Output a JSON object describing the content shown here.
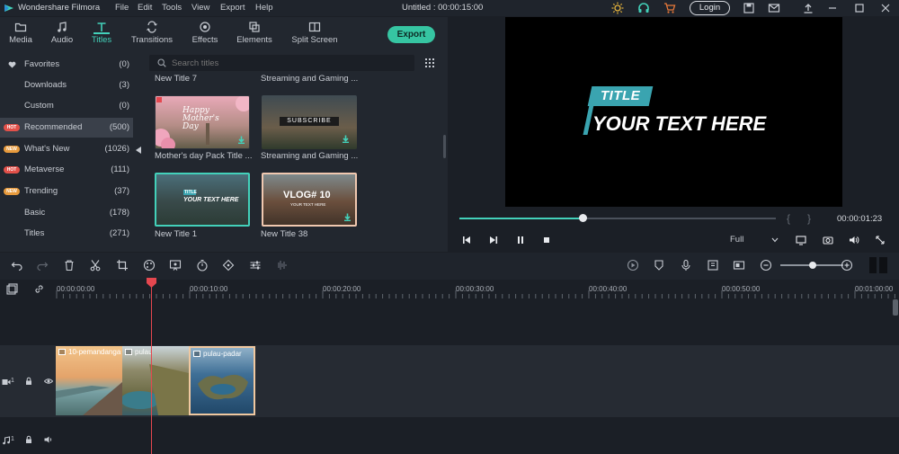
{
  "titlebar": {
    "app_name": "Wondershare Filmora",
    "menus": [
      "File",
      "Edit",
      "Tools",
      "View",
      "Export",
      "Help"
    ],
    "doc_title": "Untitled : 00:00:15:00",
    "login": "Login"
  },
  "tabs": [
    {
      "label": "Media",
      "icon": "folder-icon"
    },
    {
      "label": "Audio",
      "icon": "music-note-icon"
    },
    {
      "label": "Titles",
      "icon": "text-t-icon"
    },
    {
      "label": "Transitions",
      "icon": "transition-icon"
    },
    {
      "label": "Effects",
      "icon": "effects-icon"
    },
    {
      "label": "Elements",
      "icon": "elements-icon"
    },
    {
      "label": "Split Screen",
      "icon": "split-screen-icon"
    }
  ],
  "active_tab": "Titles",
  "export_label": "Export",
  "sidebar": {
    "items": [
      {
        "label": "Favorites",
        "count": "(0)",
        "badge": "",
        "icon": "heart-icon"
      },
      {
        "label": "Downloads",
        "count": "(3)",
        "badge": ""
      },
      {
        "label": "Custom",
        "count": "(0)",
        "badge": ""
      },
      {
        "label": "Recommended",
        "count": "(500)",
        "badge": "HOT",
        "selected": true
      },
      {
        "label": "What's New",
        "count": "(1026)",
        "badge": "NEW"
      },
      {
        "label": "Metaverse",
        "count": "(111)",
        "badge": "HOT"
      },
      {
        "label": "Trending",
        "count": "(37)",
        "badge": "NEW"
      },
      {
        "label": "Basic",
        "count": "(178)",
        "badge": ""
      },
      {
        "label": "Titles",
        "count": "(271)",
        "badge": ""
      }
    ]
  },
  "search": {
    "placeholder": "Search titles"
  },
  "grid": {
    "top_captions": [
      "New Title 7",
      "Streaming and Gaming ..."
    ],
    "items": [
      {
        "caption": "Mother's day Pack Title ...",
        "overlay": "Happy Mother's Day",
        "downloadable": true
      },
      {
        "caption": "Streaming and Gaming ...",
        "overlay": "SUBSCRIBE",
        "downloadable": true
      },
      {
        "caption": "New Title 1",
        "overlay": "YOUR TEXT HERE",
        "small": "TITLE",
        "downloadable": false
      },
      {
        "caption": "New Title 38",
        "overlay": "VLOG# 10",
        "small": "YOUR TEXT HERE",
        "downloadable": true
      }
    ]
  },
  "preview": {
    "tag": "TITLE",
    "main_text": "YOUR TEXT HERE",
    "progress": 0.39,
    "timecode": "00:00:01:23",
    "quality": "Full"
  },
  "timeline": {
    "ticks": [
      "00:00:00:00",
      "00:00:10:00",
      "00:00:20:00",
      "00:00:30:00",
      "00:00:40:00",
      "00:00:50:00",
      "00:01:00:00"
    ],
    "clips": [
      {
        "label": "10-pemandanga"
      },
      {
        "label": "pulau"
      },
      {
        "label": "pulau-padar"
      }
    ],
    "video_track_label": "1",
    "audio_track_label": "1"
  },
  "colors": {
    "accent": "#43d1ba",
    "export": "#36c5a2",
    "playhead": "#e5474f",
    "hot": "#e2514a",
    "new": "#e79a3c"
  }
}
